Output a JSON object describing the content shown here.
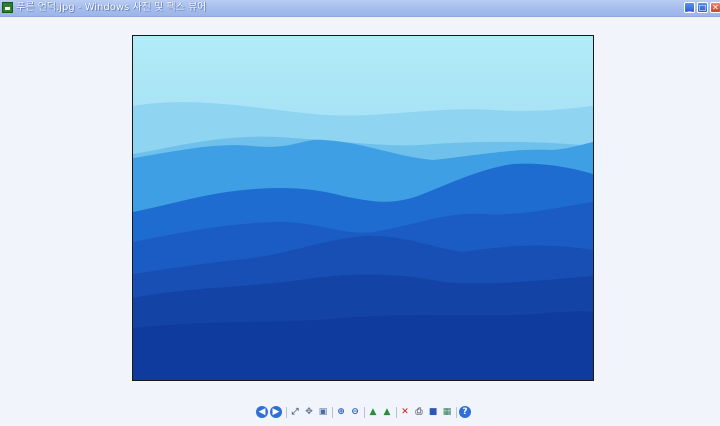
{
  "window": {
    "title": "푸른 언덕.jpg - Windows 사진 및 팩스 뷰어",
    "buttons": {
      "minimize": "_",
      "maximize": "□",
      "close": "✕"
    }
  },
  "photo": {
    "subject": "blue hills",
    "colors": {
      "sky": "#aeeaf8",
      "near_ridge": "#0f3a9e",
      "frame_border": "#1a1a1a"
    }
  },
  "toolbar": {
    "items": [
      {
        "icon": "previous-image-icon",
        "glyph": "◀"
      },
      {
        "icon": "next-image-icon",
        "glyph": "▶"
      },
      {
        "icon": "best-fit-icon",
        "glyph": "⤢"
      },
      {
        "icon": "actual-size-icon",
        "glyph": "✥"
      },
      {
        "icon": "slideshow-icon",
        "glyph": "▣"
      },
      {
        "icon": "zoom-in-icon",
        "glyph": "⊕"
      },
      {
        "icon": "zoom-out-icon",
        "glyph": "⊖"
      },
      {
        "icon": "rotate-clockwise-icon",
        "glyph": "▲"
      },
      {
        "icon": "rotate-counterclockwise-icon",
        "glyph": "▲"
      },
      {
        "icon": "delete-icon",
        "glyph": "✕"
      },
      {
        "icon": "print-icon",
        "glyph": "⎙"
      },
      {
        "icon": "save-icon",
        "glyph": "■"
      },
      {
        "icon": "open-for-editing-icon",
        "glyph": "▦"
      },
      {
        "icon": "help-icon",
        "glyph": "?"
      }
    ]
  }
}
